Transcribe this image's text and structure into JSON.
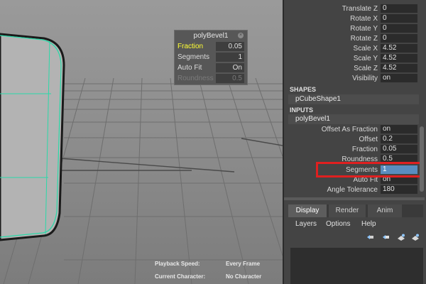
{
  "poly_bevel_panel": {
    "title": "polyBevel1",
    "rows": [
      {
        "label": "Fraction",
        "value": "0.05"
      },
      {
        "label": "Segments",
        "value": "1"
      },
      {
        "label": "Auto Fit",
        "value": "On"
      },
      {
        "label": "Roundness",
        "value": "0.5"
      }
    ]
  },
  "hud": {
    "playback_speed_label": "Playback Speed:",
    "playback_speed_value": "Every Frame",
    "current_character_label": "Current Character:",
    "current_character_value": "No Character"
  },
  "transform": [
    {
      "label": "Translate Z",
      "value": "0"
    },
    {
      "label": "Rotate X",
      "value": "0"
    },
    {
      "label": "Rotate Y",
      "value": "0"
    },
    {
      "label": "Rotate Z",
      "value": "0"
    },
    {
      "label": "Scale X",
      "value": "4.52"
    },
    {
      "label": "Scale Y",
      "value": "4.52"
    },
    {
      "label": "Scale Z",
      "value": "4.52"
    },
    {
      "label": "Visibility",
      "value": "on"
    }
  ],
  "shapes": {
    "header": "SHAPES",
    "node": "pCubeShape1"
  },
  "inputs": {
    "header": "INPUTS",
    "node": "polyBevel1",
    "rows": [
      {
        "label": "Offset As Fraction",
        "value": "on"
      },
      {
        "label": "Offset",
        "value": "0.2"
      },
      {
        "label": "Fraction",
        "value": "0.05"
      },
      {
        "label": "Roundness",
        "value": "0.5"
      },
      {
        "label": "Segments",
        "value": "1"
      },
      {
        "label": "Auto Fit",
        "value": "on"
      },
      {
        "label": "Angle Tolerance",
        "value": "180"
      }
    ]
  },
  "tabs": [
    "Display",
    "Render",
    "Anim"
  ],
  "layer_menu": [
    "Layers",
    "Options",
    "Help"
  ],
  "icons": [
    "layer-move-up-icon",
    "layer-move-down-icon",
    "new-layer-icon",
    "new-layer-selected-icon"
  ],
  "colors": {
    "highlight": "#ffff33",
    "selection": "#5a8dbf",
    "edge": "#2ad9a8",
    "callout": "#e02020"
  }
}
